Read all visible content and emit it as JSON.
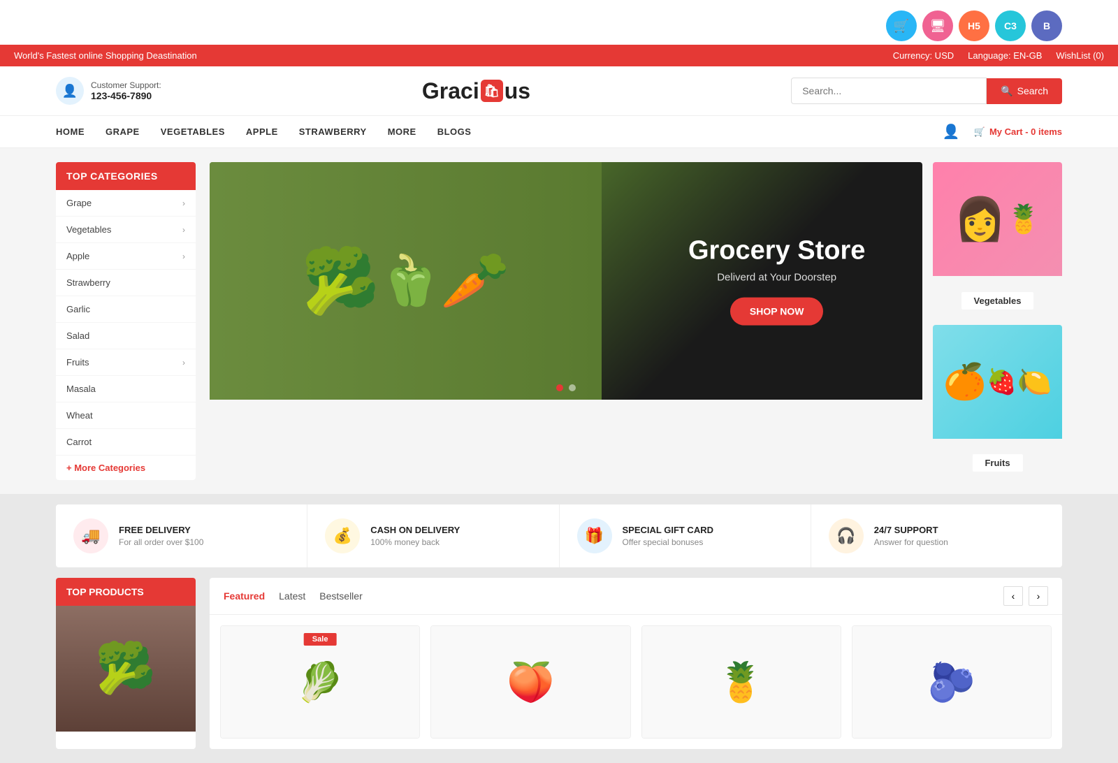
{
  "site": {
    "name_start": "Graci",
    "name_end": "us",
    "logo_icon": "🛍"
  },
  "top_bar": {
    "announcement": "World's Fastest online Shopping Deastination",
    "currency_label": "Currency: USD",
    "language_label": "Language: EN-GB",
    "wishlist_label": "WishList (0)"
  },
  "header": {
    "support_label": "Customer Support:",
    "support_number": "123-456-7890",
    "search_placeholder": "Search...",
    "search_button": "Search"
  },
  "nav": {
    "links": [
      {
        "label": "HOME",
        "key": "home"
      },
      {
        "label": "GRAPE",
        "key": "grape"
      },
      {
        "label": "VEGETABLES",
        "key": "vegetables"
      },
      {
        "label": "APPLE",
        "key": "apple"
      },
      {
        "label": "STRAWBERRY",
        "key": "strawberry"
      },
      {
        "label": "MORE",
        "key": "more"
      },
      {
        "label": "BLOGS",
        "key": "blogs"
      }
    ],
    "cart_label": "My Cart - 0 items"
  },
  "sidebar": {
    "title": "TOP CATEGORIES",
    "items": [
      {
        "label": "Grape",
        "has_arrow": true
      },
      {
        "label": "Vegetables",
        "has_arrow": true
      },
      {
        "label": "Apple",
        "has_arrow": true
      },
      {
        "label": "Strawberry",
        "has_arrow": false
      },
      {
        "label": "Garlic",
        "has_arrow": false
      },
      {
        "label": "Salad",
        "has_arrow": false
      },
      {
        "label": "Fruits",
        "has_arrow": true
      },
      {
        "label": "Masala",
        "has_arrow": false
      },
      {
        "label": "Wheat",
        "has_arrow": false
      },
      {
        "label": "Carrot",
        "has_arrow": false
      }
    ],
    "more_label": "+ More Categories"
  },
  "hero": {
    "title": "Grocery Store",
    "subtitle": "Deliverd at Your Doorstep",
    "button": "SHOP NOW"
  },
  "side_banners": [
    {
      "label": "Vegetables",
      "style": "pink",
      "icon": "👩"
    },
    {
      "label": "Fruits",
      "style": "cyan",
      "icon": "🍊"
    }
  ],
  "features": [
    {
      "icon": "🚚",
      "icon_style": "red",
      "title": "FREE DELIVERY",
      "desc": "For all order over $100"
    },
    {
      "icon": "💰",
      "icon_style": "yellow",
      "title": "CASH ON DELIVERY",
      "desc": "100% money back"
    },
    {
      "icon": "🎁",
      "icon_style": "blue",
      "title": "SPECIAL GIFT CARD",
      "desc": "Offer special bonuses"
    },
    {
      "icon": "🎧",
      "icon_style": "orange",
      "title": "24/7 SUPPORT",
      "desc": "Answer for question"
    }
  ],
  "top_products": {
    "sidebar_title": "TOP PRODUCTS",
    "tabs": [
      {
        "label": "Featured",
        "active": true
      },
      {
        "label": "Latest",
        "active": false
      },
      {
        "label": "Bestseller",
        "active": false
      }
    ],
    "sale_badge": "Sale"
  },
  "top_icons": [
    {
      "icon": "🛒",
      "style": "ti-blue"
    },
    {
      "icon": "🖥",
      "style": "ti-pink"
    },
    {
      "icon": "H",
      "style": "ti-orange"
    },
    {
      "icon": "C",
      "style": "ti-teal"
    },
    {
      "icon": "B",
      "style": "ti-purple"
    }
  ]
}
